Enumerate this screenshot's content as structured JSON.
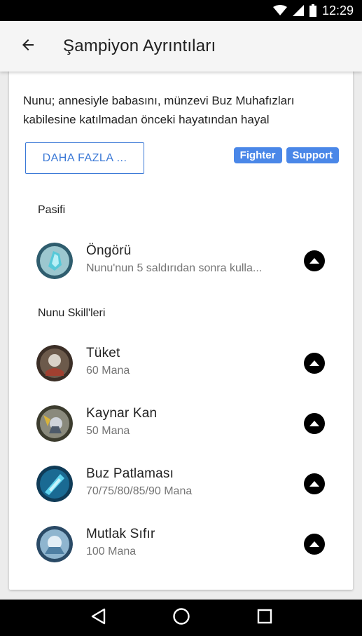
{
  "status_bar": {
    "time": "12:29"
  },
  "app_bar": {
    "title": "Şampiyon Ayrıntıları"
  },
  "card": {
    "lore": "Nunu; annesiyle babasını, münzevi Buz Muhafızları kabilesine katılmadan önceki hayatından hayal",
    "more_button": "DAHA FAZLA ...",
    "tags": [
      "Fighter",
      "Support"
    ],
    "passive_title": "Pasifi",
    "passive": {
      "name": "Öngörü",
      "sub": "Nunu'nun 5 saldırıdan sonra kulla..."
    },
    "skills_title": "Nunu Skill'leri",
    "skills": [
      {
        "name": "Tüket",
        "sub": "60 Mana"
      },
      {
        "name": "Kaynar Kan",
        "sub": "50 Mana"
      },
      {
        "name": "Buz Patlaması",
        "sub": "70/75/80/85/90 Mana"
      },
      {
        "name": "Mutlak Sıfır",
        "sub": "100 Mana"
      }
    ]
  },
  "colors": {
    "accent": "#4a87e8",
    "button_outline": "#3a78d6"
  },
  "icons": {
    "back": "arrow-left-icon",
    "expand": "expand-up-icon",
    "nav_back": "triangle-back-icon",
    "nav_home": "circle-home-icon",
    "nav_recents": "square-recents-icon"
  }
}
